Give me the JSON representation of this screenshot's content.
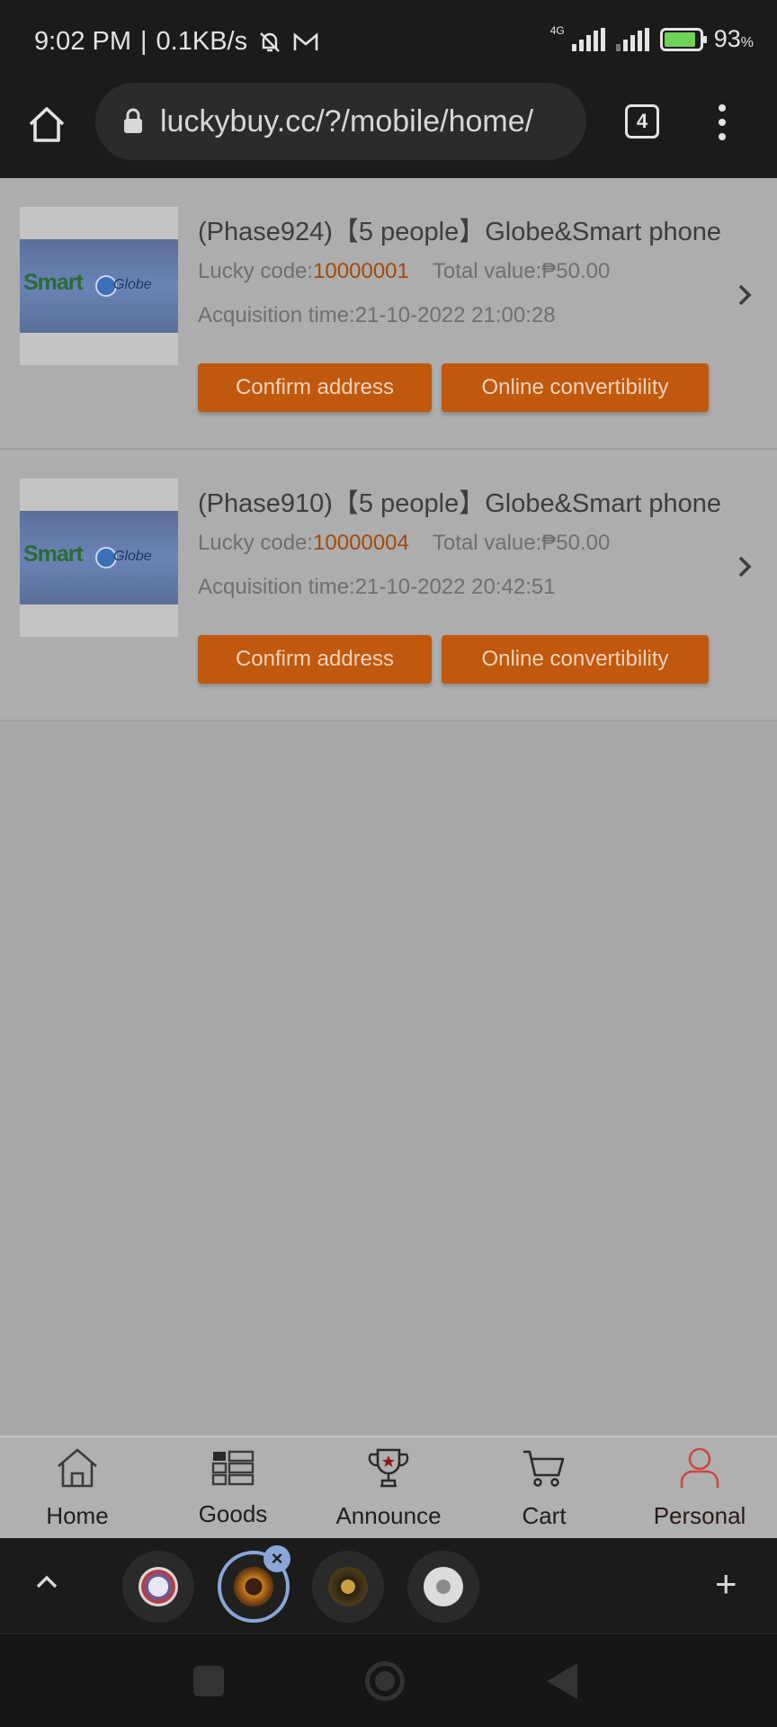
{
  "status_bar": {
    "time": "9:02 PM",
    "speed": "0.1KB/s",
    "network_tag": "4G",
    "battery_percent": "93",
    "battery_unit": "%"
  },
  "browser": {
    "url": "luckybuy.cc/?/mobile/home/",
    "tab_count": "4"
  },
  "orders": [
    {
      "title": "(Phase924)【5 people】Globe&Smart phone",
      "lucky_code_label": "Lucky code:",
      "lucky_code": "10000001",
      "total_value": "Total value:₱50.00",
      "acquisition_time": "Acquisition time:21-10-2022 21:00:28",
      "confirm_label": "Confirm address",
      "online_label": "Online convertibility",
      "thumb_brand_left": "Smart",
      "thumb_brand_right": "Globe"
    },
    {
      "title": "(Phase910)【5 people】Globe&Smart phone",
      "lucky_code_label": "Lucky code:",
      "lucky_code": "10000004",
      "total_value": "Total value:₱50.00",
      "acquisition_time": "Acquisition time:21-10-2022 20:42:51",
      "confirm_label": "Confirm address",
      "online_label": "Online convertibility",
      "thumb_brand_left": "Smart",
      "thumb_brand_right": "Globe"
    }
  ],
  "bottom_nav": {
    "home": "Home",
    "goods": "Goods",
    "announce": "Announce",
    "cart": "Cart",
    "personal": "Personal"
  },
  "colors": {
    "accent": "#c0590d",
    "code_value": "#a34a0c",
    "active_nav": "#d9463a",
    "tab_active_ring": "#8aa7d8"
  },
  "icons": [
    "home-icon",
    "lock-icon",
    "tabs-icon",
    "more-vert-icon",
    "chevron-right-icon",
    "goods-grid-icon",
    "trophy-icon",
    "cart-icon",
    "person-icon",
    "chevron-up-icon",
    "close-icon",
    "plus-icon"
  ]
}
